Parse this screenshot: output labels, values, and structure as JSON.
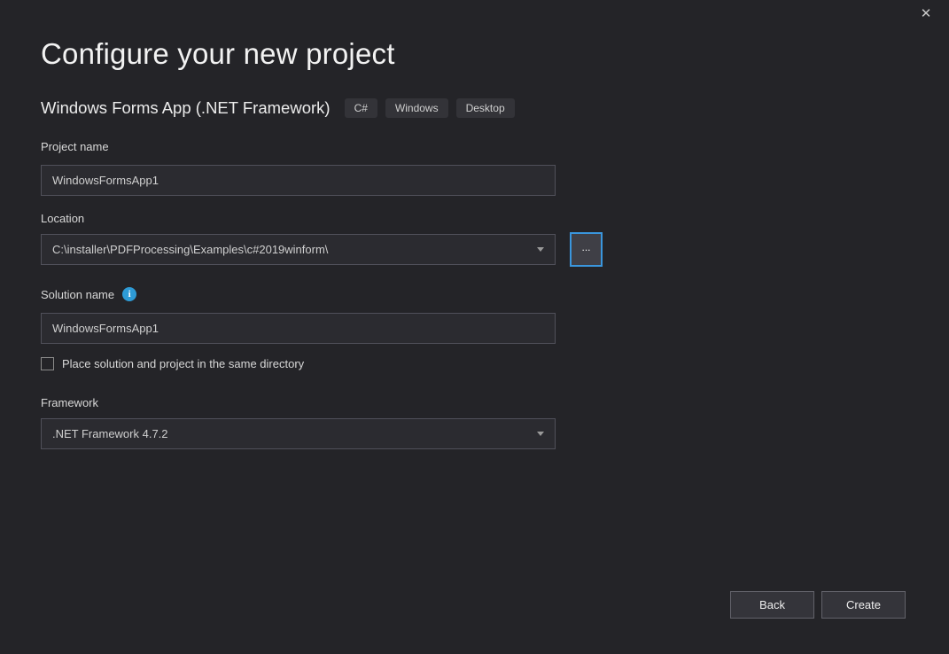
{
  "window": {
    "close_icon": "✕"
  },
  "header": {
    "title": "Configure your new project"
  },
  "project_type": {
    "name": "Windows Forms App (.NET Framework)",
    "tags": [
      "C#",
      "Windows",
      "Desktop"
    ]
  },
  "form": {
    "project_name": {
      "label": "Project name",
      "value": "WindowsFormsApp1"
    },
    "location": {
      "label": "Location",
      "value": "C:\\installer\\PDFProcessing\\Examples\\c#2019winform\\",
      "browse_label": "..."
    },
    "solution_name": {
      "label": "Solution name",
      "info_icon": "i",
      "value": "WindowsFormsApp1"
    },
    "same_directory": {
      "label": "Place solution and project in the same directory",
      "checked": false
    },
    "framework": {
      "label": "Framework",
      "value": ".NET Framework 4.7.2"
    }
  },
  "footer": {
    "back_label": "Back",
    "create_label": "Create"
  },
  "colors": {
    "background": "#242428",
    "input_background": "#2b2b30",
    "input_border": "#50505a",
    "accent_blue": "#3A96DD",
    "info_blue": "#2E9BD6"
  }
}
